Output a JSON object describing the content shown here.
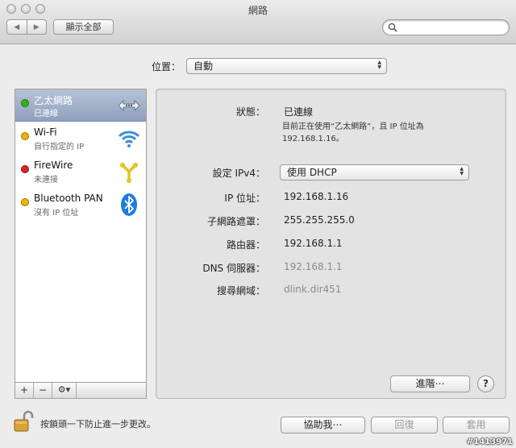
{
  "window": {
    "title": "網路",
    "show_all_label": "顯示全部",
    "search_placeholder": ""
  },
  "location": {
    "label": "位置：",
    "value": "自動"
  },
  "services": [
    {
      "name": "乙太網路",
      "status": "已連線",
      "status_color": "#36b21c",
      "icon": "ethernet-icon",
      "selected": true
    },
    {
      "name": "Wi-Fi",
      "status": "自行指定的 IP",
      "status_color": "#f0b400",
      "icon": "wifi-icon",
      "selected": false
    },
    {
      "name": "FireWire",
      "status": "未連接",
      "status_color": "#d8222a",
      "icon": "firewire-icon",
      "selected": false
    },
    {
      "name": "Bluetooth PAN",
      "status": "沒有 IP 位址",
      "status_color": "#f0b400",
      "icon": "bluetooth-icon",
      "selected": false
    }
  ],
  "sidebar_buttons": {
    "add": "+",
    "remove": "−",
    "action": "⚙▾"
  },
  "details": {
    "status_label": "狀態：",
    "status_value": "已連線",
    "status_note_line1": "目前正在使用“乙太網路”，且 IP 位址為",
    "status_note_line2": "192.168.1.16。",
    "ipv4_label": "設定 IPv4：",
    "ipv4_value": "使用 DHCP",
    "ip_label": "IP 位址：",
    "ip_value": "192.168.1.16",
    "subnet_label": "子網路遮罩：",
    "subnet_value": "255.255.255.0",
    "router_label": "路由器：",
    "router_value": "192.168.1.1",
    "dns_label": "DNS 伺服器：",
    "dns_value": "192.168.1.1",
    "search_domain_label": "搜尋網域：",
    "search_domain_value": "dlink.dir451",
    "advanced_label": "進階⋯",
    "help_label": "?"
  },
  "footer": {
    "lock_text": "按鎖頭一下防止進一步更改。",
    "assist_label": "協助我⋯",
    "revert_label": "回復",
    "apply_label": "套用"
  },
  "watermark": "#1413971",
  "colors": {
    "selected_row": "#8fa0bd",
    "pane_bg": "#e3e3e3",
    "bluetooth": "#1e7be0",
    "wifi": "#3a8fd8",
    "firewire": "#e8c21e"
  }
}
